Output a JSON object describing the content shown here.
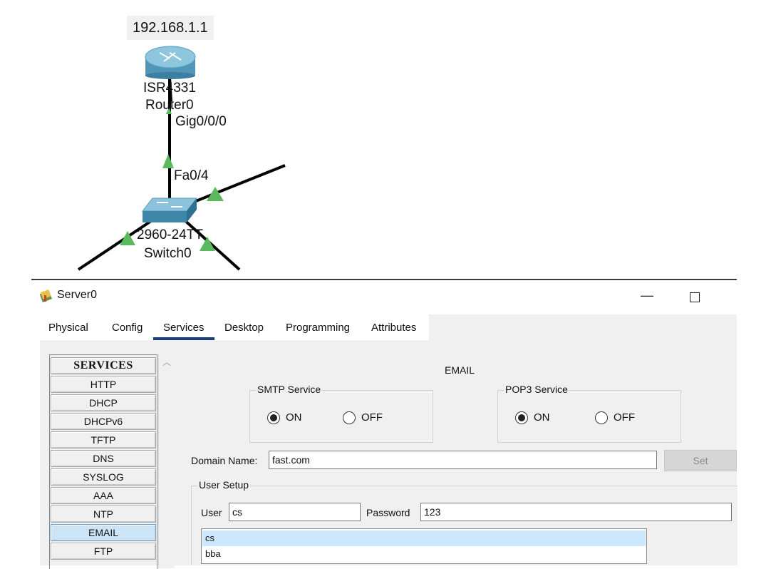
{
  "topology": {
    "router": {
      "ip": "192.168.1.1",
      "model": "ISR4331",
      "name": "Router0",
      "port": "Gig0/0/0"
    },
    "switch": {
      "model": "2960-24TT",
      "name": "Switch0",
      "port": "Fa0/4"
    }
  },
  "window": {
    "title": "Server0",
    "minimize_glyph": "—",
    "tabs": [
      "Physical",
      "Config",
      "Services",
      "Desktop",
      "Programming",
      "Attributes"
    ],
    "active_tab": "Services"
  },
  "services": {
    "header": "SERVICES",
    "items": [
      "HTTP",
      "DHCP",
      "DHCPv6",
      "TFTP",
      "DNS",
      "SYSLOG",
      "AAA",
      "NTP",
      "EMAIL",
      "FTP"
    ],
    "selected": "EMAIL"
  },
  "email": {
    "title": "EMAIL",
    "smtp": {
      "legend": "SMTP Service",
      "on_label": "ON",
      "off_label": "OFF",
      "state": "ON"
    },
    "pop3": {
      "legend": "POP3 Service",
      "on_label": "ON",
      "off_label": "OFF",
      "state": "ON"
    },
    "domain_label": "Domain Name:",
    "domain_value": "fast.com",
    "set_label": "Set",
    "user_setup_legend": "User Setup",
    "user_label": "User",
    "user_value": "cs",
    "password_label": "Password",
    "password_value": "123",
    "users": [
      "cs",
      "bba"
    ],
    "selected_user": "cs"
  },
  "colors": {
    "link": "#000000",
    "link_marker": "#5cb85c",
    "tab_underline": "#1a3e7a",
    "selection": "#cce8ff"
  }
}
